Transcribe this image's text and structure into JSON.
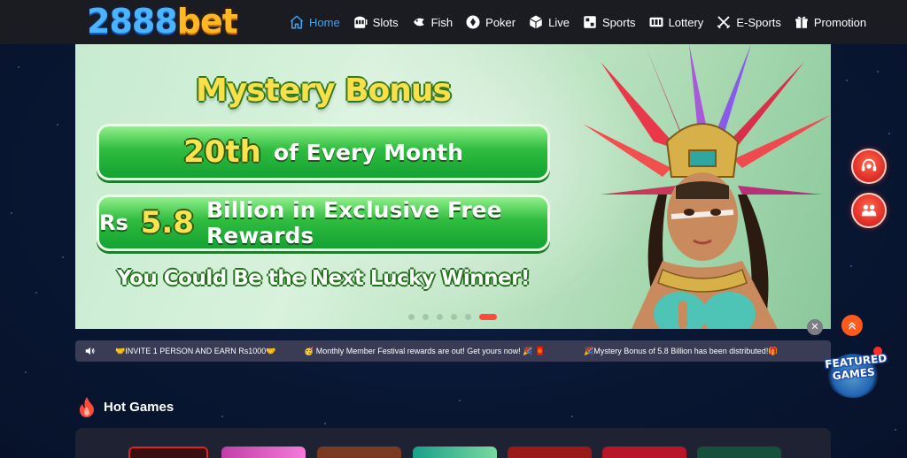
{
  "logo": {
    "number_part": "2888",
    "text_part": "bet"
  },
  "nav": {
    "items": [
      {
        "label": "Home",
        "icon": "home-icon",
        "active": true
      },
      {
        "label": "Slots",
        "icon": "slots-icon",
        "active": false
      },
      {
        "label": "Fish",
        "icon": "fish-icon",
        "active": false
      },
      {
        "label": "Poker",
        "icon": "poker-icon",
        "active": false
      },
      {
        "label": "Live",
        "icon": "live-icon",
        "active": false
      },
      {
        "label": "Sports",
        "icon": "sports-icon",
        "active": false
      },
      {
        "label": "Lottery",
        "icon": "lottery-icon",
        "active": false
      },
      {
        "label": "E-Sports",
        "icon": "esports-icon",
        "active": false
      },
      {
        "label": "Promotion",
        "icon": "gift-icon",
        "active": false
      }
    ]
  },
  "banner": {
    "title": "Mystery Bonus",
    "date_big": "20th",
    "date_rest": "of Every Month",
    "currency": "Rs",
    "amount": "5.8",
    "amount_rest": "Billion in Exclusive Free Rewards",
    "subtitle": "You Could Be the Next Lucky Winner!",
    "slides_total": 6,
    "active_slide": 6
  },
  "marquee": {
    "messages": [
      "🤝INVITE 1 PERSON AND EARN Rs1000🤝",
      "🥳 Monthly Member Festival rewards are out! Get yours now! 🎉 🧧",
      "🎉Mystery Bonus of 5.8 Billion has been distributed!🎁"
    ]
  },
  "featured": {
    "label": "FEATURED GAMES"
  },
  "hot_games": {
    "title": "Hot Games"
  },
  "colors": {
    "header_bg": "#1b1c22",
    "page_bg": "#091733",
    "nav_active": "#3aa6ff",
    "accent_red": "#e3322a",
    "accent_orange": "#ff5b1d"
  }
}
